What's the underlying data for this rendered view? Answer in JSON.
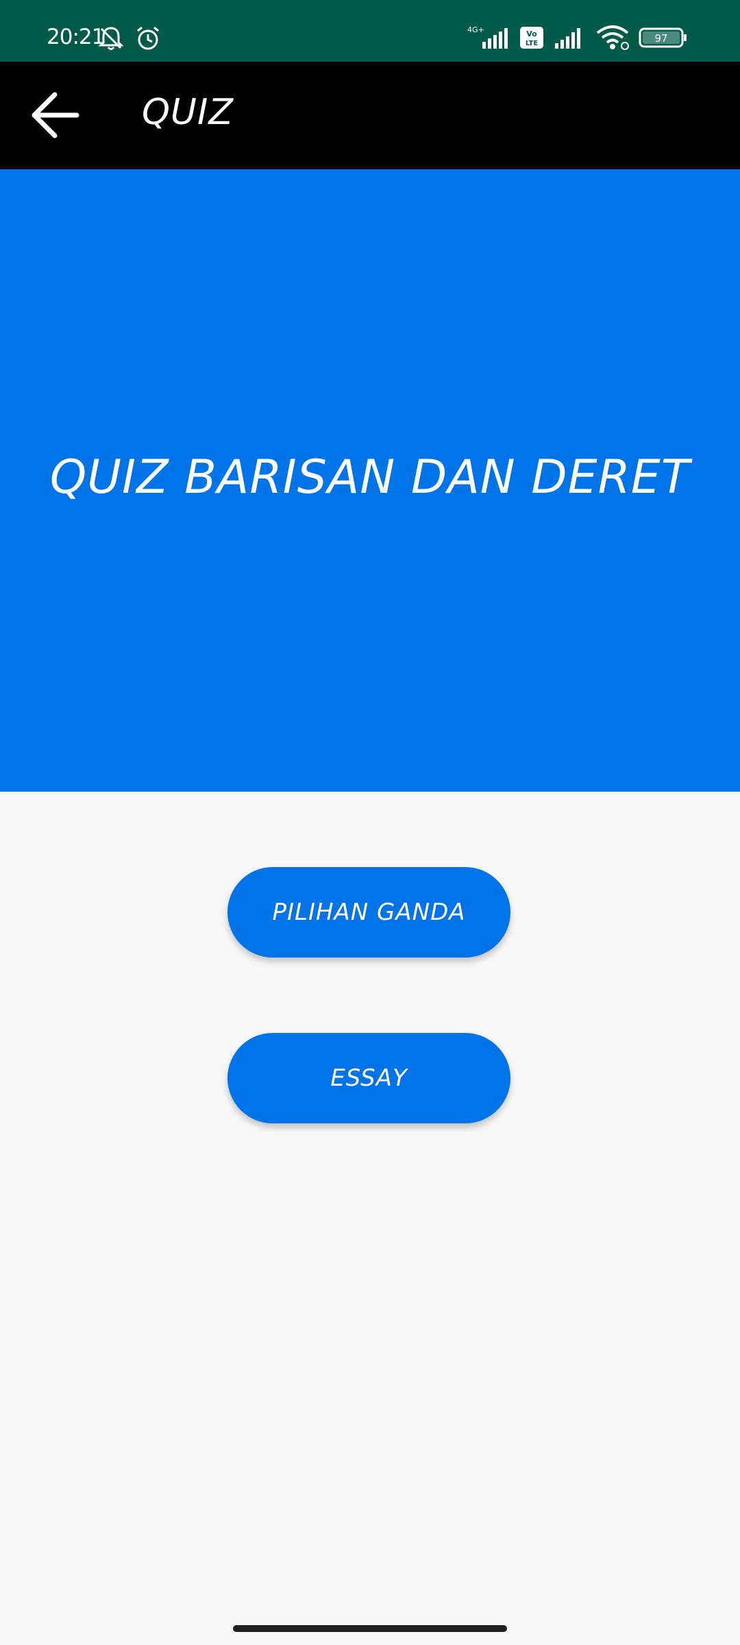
{
  "status_bar": {
    "time": "20:21",
    "battery": "97",
    "icons": [
      "bell-muted-icon",
      "alarm-icon",
      "signal-4g-icon",
      "volte-icon",
      "signal-icon",
      "wifi-icon",
      "battery-icon"
    ],
    "network_label": "4G+",
    "volte_label": "Vo LTE"
  },
  "app_bar": {
    "title": "QUIZ",
    "back_icon": "arrow-left-icon"
  },
  "hero": {
    "title": "QUIZ BARISAN DAN DERET"
  },
  "buttons": {
    "multiple_choice": "PILIHAN GANDA",
    "essay": "ESSAY"
  },
  "colors": {
    "status_bar": "#01594a",
    "app_bar": "#000000",
    "accent": "#0073e6",
    "background": "#f8f8f9"
  }
}
